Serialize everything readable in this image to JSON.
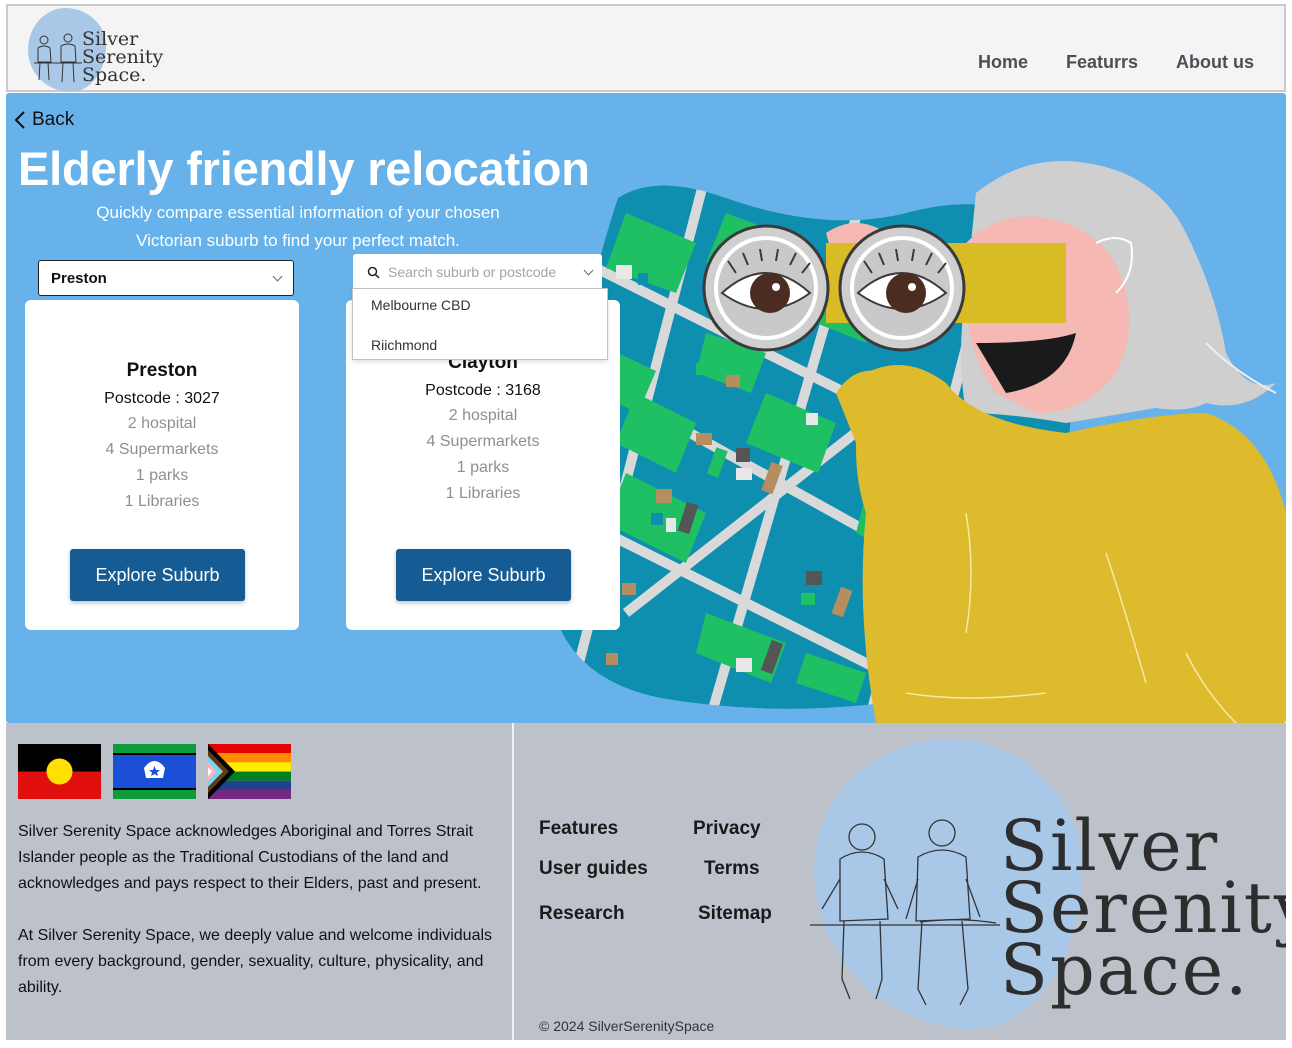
{
  "header": {
    "logo_text": [
      "Silver",
      "Serenity",
      "Space."
    ],
    "nav": [
      "Home",
      "Featurrs",
      "About us"
    ]
  },
  "hero": {
    "back_label": "Back",
    "title": "Elderly friendly relocation",
    "subtitle_line1": "Quickly compare essential information of your chosen",
    "subtitle_line2": "Victorian suburb to find your perfect match.",
    "selected_suburb": "Preston",
    "search_placeholder": "Search suburb or postcode",
    "dropdown_options": [
      "Melbourne CBD",
      "Riichmond"
    ]
  },
  "cards": [
    {
      "name": "Preston",
      "postcode": "Postcode : 3027",
      "stats": [
        "2 hospital",
        "4 Supermarkets",
        "1  parks",
        "1 Libraries"
      ],
      "button": "Explore Suburb"
    },
    {
      "name": "Clayton",
      "postcode": "Postcode : 3168",
      "stats": [
        "2 hospital",
        "4 Supermarkets",
        "1  parks",
        "1 Libraries"
      ],
      "button": "Explore Suburb"
    }
  ],
  "footer": {
    "acknowledgement": "Silver Serenity Space acknowledges Aboriginal and Torres Strait Islander people as the Traditional Custodians of the land  and acknowledges and pays respect to their Elders, past and present.",
    "welcome": "At Silver Serenity Space, we deeply value and welcome individuals from every background, gender, sexuality, culture, physicality, and ability.",
    "links": {
      "features": "Features",
      "privacy": "Privacy",
      "user_guides": "User guides",
      "terms": "Terms",
      "research": "Research",
      "sitemap": "Sitemap"
    },
    "copyright": "© 2024 SilverSerenitySpace",
    "logo_text": [
      "Silver",
      "Serenity",
      "Space."
    ]
  },
  "colors": {
    "hero_bg": "#67b2ea",
    "button": "#155c94",
    "footer_bg": "#bdc1c9",
    "map_water": "#0f8fb0",
    "map_green": "#1fc063",
    "sweater": "#ddbb2c"
  }
}
